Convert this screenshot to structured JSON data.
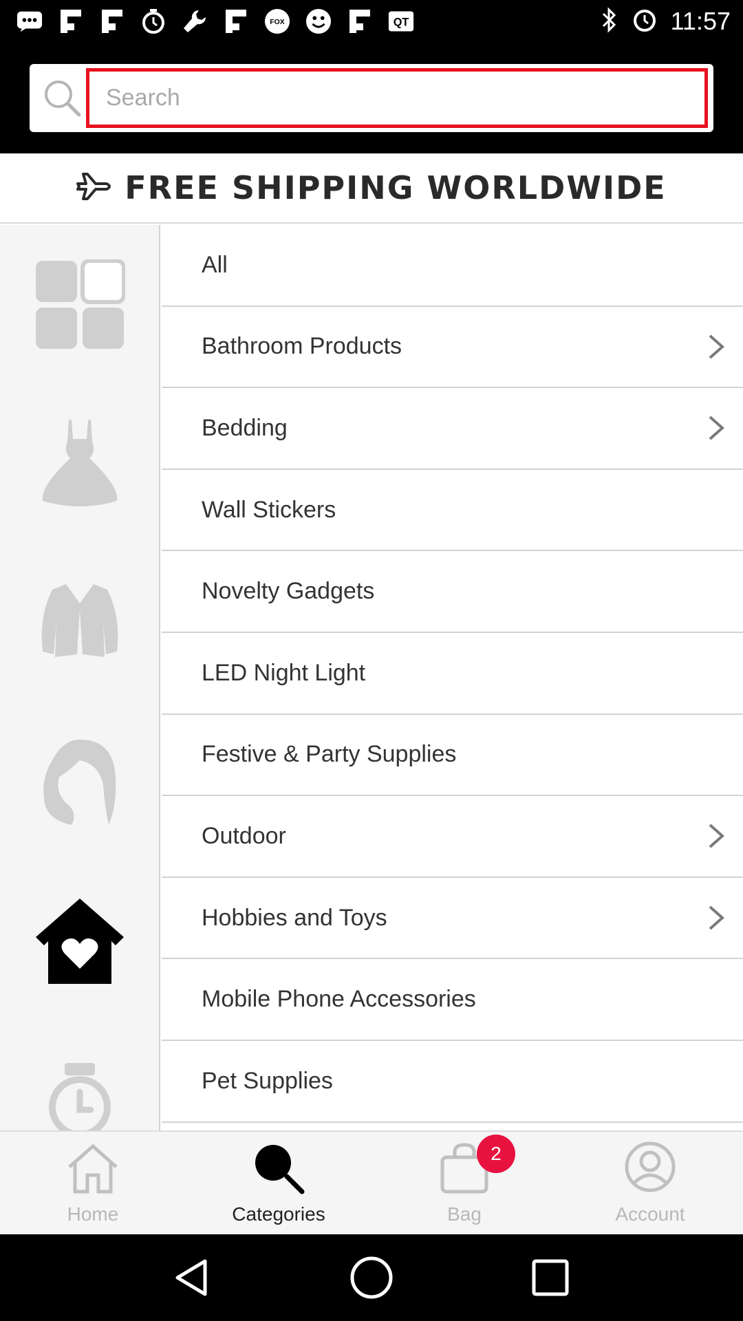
{
  "status_bar": {
    "time": "11:57",
    "left_icons": [
      "messages-icon",
      "flipboard-icon",
      "flipboard-icon",
      "stopwatch-icon",
      "wrench-icon",
      "flipboard-icon",
      "fox-sports-icon",
      "smiley-icon",
      "flipboard-icon",
      "qt-icon"
    ],
    "fox_label": "FOX",
    "qt_label": "QT",
    "right_icons": [
      "bluetooth-icon",
      "alarm-icon"
    ]
  },
  "search": {
    "placeholder": "Search",
    "value": "",
    "highlight_color": "#e8121e"
  },
  "banner": {
    "text": "FREE SHIPPING WORLDWIDE"
  },
  "rail": {
    "icons": [
      "grid-icon",
      "dress-icon",
      "jacket-icon",
      "woman-hair-icon",
      "home-heart-icon",
      "watch-icon"
    ]
  },
  "categories": [
    {
      "label": "All",
      "has_children": false
    },
    {
      "label": "Bathroom Products",
      "has_children": true
    },
    {
      "label": "Bedding",
      "has_children": true
    },
    {
      "label": "Wall Stickers",
      "has_children": false
    },
    {
      "label": "Novelty Gadgets",
      "has_children": false
    },
    {
      "label": "LED Night Light",
      "has_children": false
    },
    {
      "label": "Festive & Party Supplies",
      "has_children": false
    },
    {
      "label": "Outdoor",
      "has_children": true
    },
    {
      "label": "Hobbies and Toys",
      "has_children": true
    },
    {
      "label": "Mobile Phone Accessories",
      "has_children": false
    },
    {
      "label": "Pet Supplies",
      "has_children": false
    }
  ],
  "bottom_nav": {
    "tabs": [
      {
        "label": "Home",
        "icon": "home-icon",
        "active": false
      },
      {
        "label": "Categories",
        "icon": "search-icon",
        "active": true
      },
      {
        "label": "Bag",
        "icon": "bag-icon",
        "active": false
      },
      {
        "label": "Account",
        "icon": "account-icon",
        "active": false
      }
    ],
    "bag_badge": "2",
    "badge_color": "#e8123f"
  },
  "system_nav": [
    "back-icon",
    "home-circle-icon",
    "recents-icon"
  ]
}
